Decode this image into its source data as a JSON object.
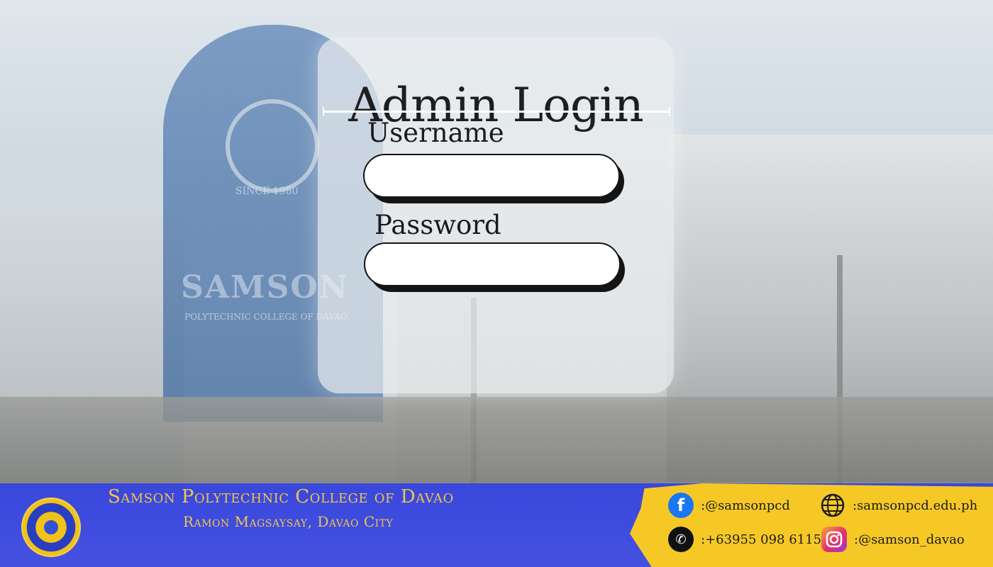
{
  "login": {
    "title": "Admin Login",
    "username_label": "Username",
    "password_label": "Password",
    "username_value": "",
    "password_value": ""
  },
  "background_sign": {
    "main": "SAMSON",
    "sub": "POLYTECHNIC COLLEGE OF DAVAO",
    "since": "SINCE 1980"
  },
  "footer": {
    "college_name": "Samson Polytechnic College of Davao",
    "address": "Ramon Magsaysay, Davao City",
    "contacts": {
      "facebook": ":@samsonpcd",
      "website": ":samsonpcd.edu.ph",
      "phone": ":+63955 098 6115",
      "instagram": ":@samson_davao"
    }
  },
  "colors": {
    "footer_bg": "#3947dc",
    "footer_text": "#f0c64a",
    "contact_panel": "#f6c826",
    "facebook": "#1877f2"
  },
  "icons": {
    "facebook": "facebook-icon",
    "website": "globe-icon",
    "phone": "phone-icon",
    "instagram": "instagram-icon"
  }
}
